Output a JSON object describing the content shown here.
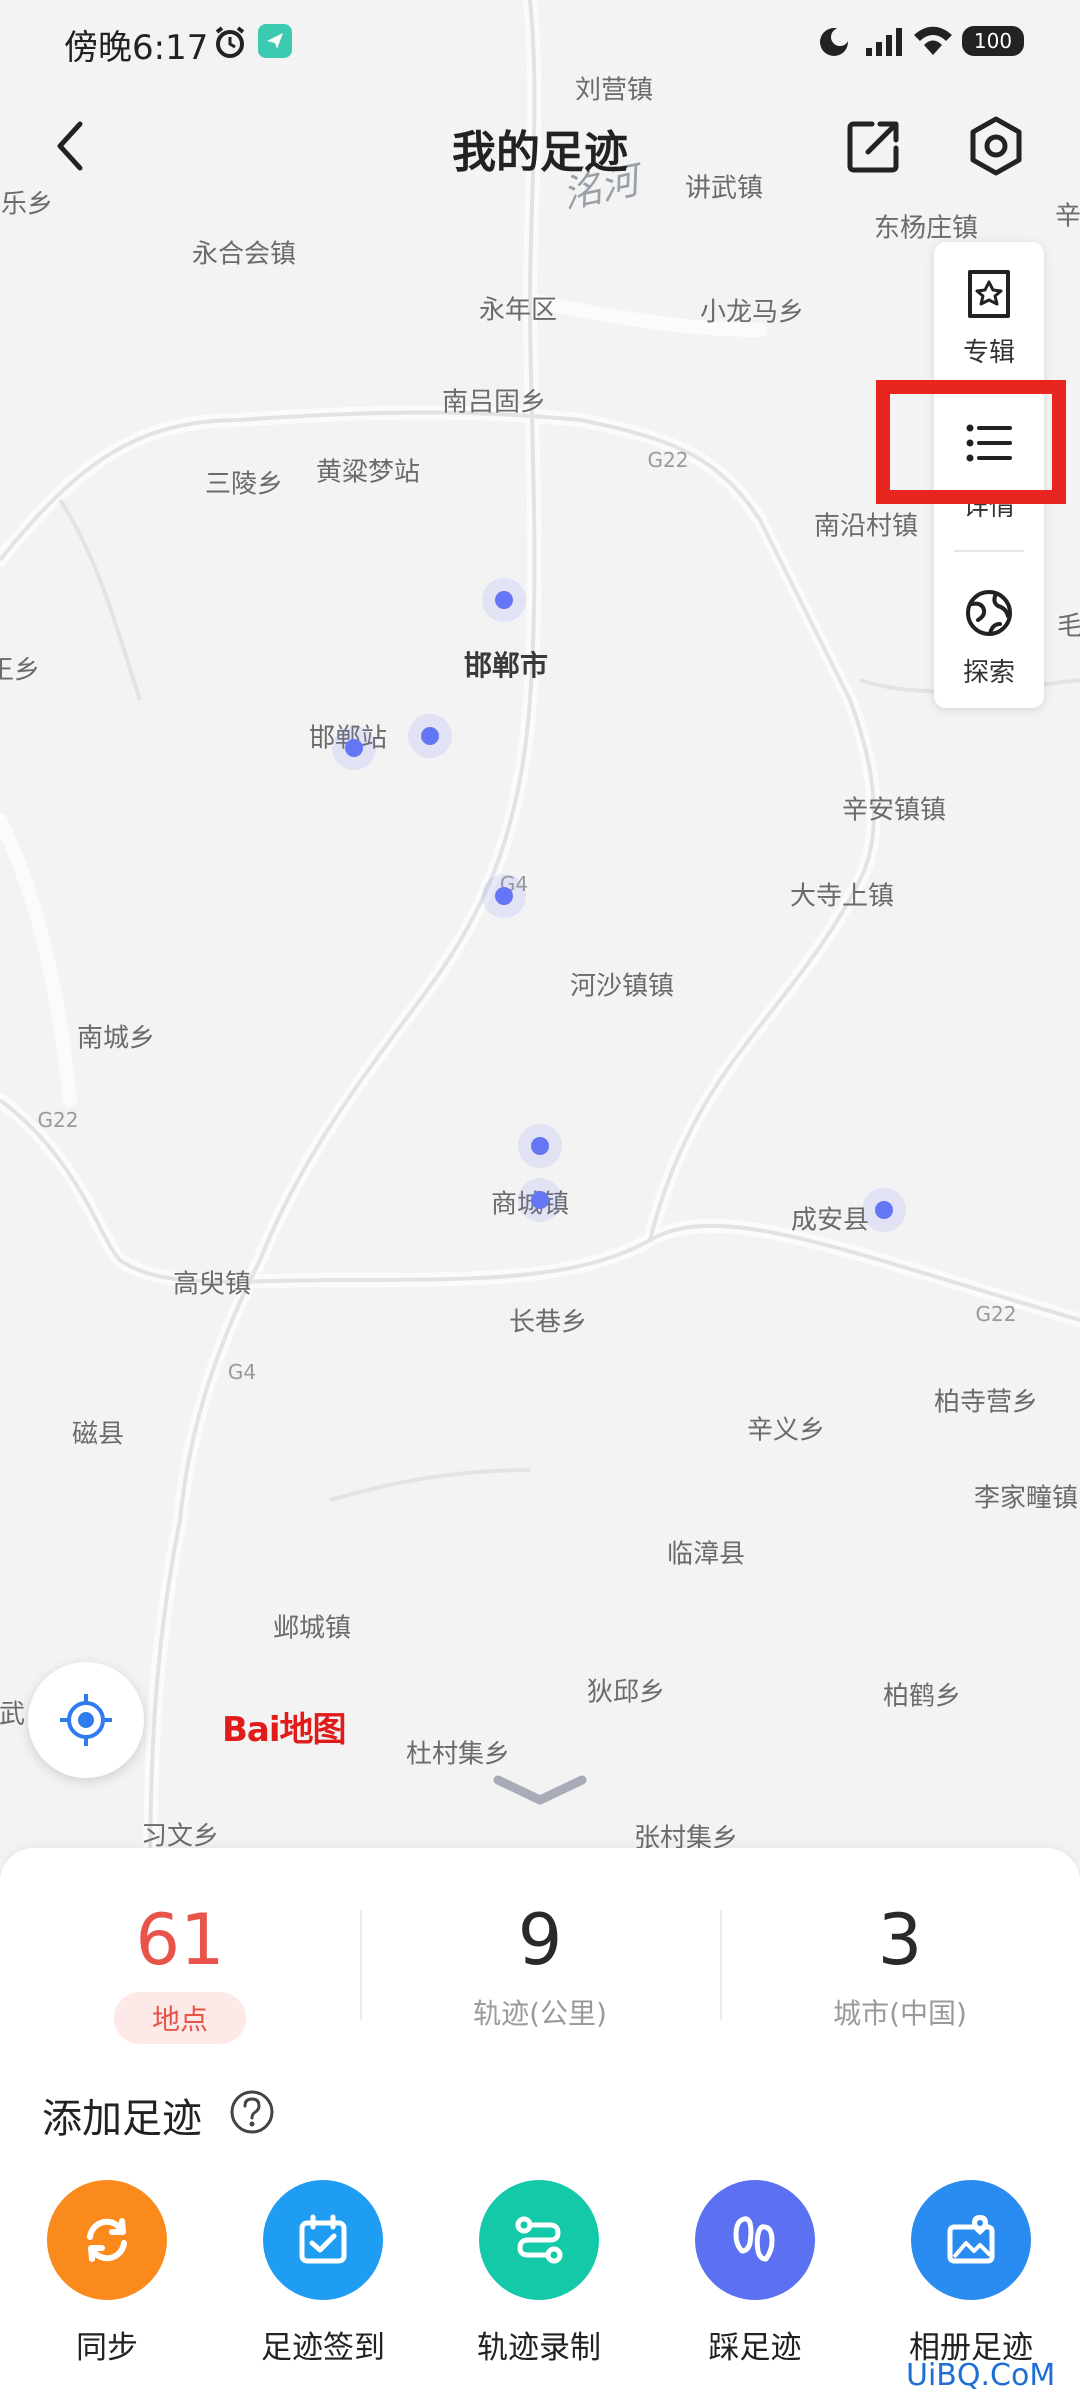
{
  "status_bar": {
    "time": "傍晚6:17",
    "battery": "100"
  },
  "header": {
    "title": "我的足迹"
  },
  "side_panel": {
    "items": [
      {
        "label": "专辑"
      },
      {
        "label": "详情"
      },
      {
        "label": "探索"
      }
    ]
  },
  "map": {
    "places": [
      "刘营镇",
      "洺河",
      "讲武镇",
      "东杨庄镇",
      "辛",
      "安乐乡",
      "永合会镇",
      "永年区",
      "小龙马乡",
      "南吕固乡",
      "三陵乡",
      "黄粱梦站",
      "G22",
      "南沿村镇",
      "邯郸市",
      "邯郸站",
      "辛安镇镇",
      "G4",
      "大寺上镇",
      "河沙镇镇",
      "南城乡",
      "G22",
      "商城镇",
      "成安县",
      "高臾镇",
      "长巷乡",
      "G22",
      "G4",
      "柏寺营乡",
      "磁县",
      "辛义乡",
      "李家疃镇",
      "临漳县",
      "邺城镇",
      "狄邱乡",
      "柏鹤乡",
      "杜村集乡",
      "习文乡",
      "张村集乡",
      "王乡",
      "毛",
      "武"
    ],
    "logo": "Bai地图"
  },
  "stats": [
    {
      "value": "61",
      "label": "地点"
    },
    {
      "value": "9",
      "label": "轨迹(公里)"
    },
    {
      "value": "3",
      "label": "城市(中国)"
    }
  ],
  "add_section": {
    "title": "添加足迹"
  },
  "actions": [
    {
      "label": "同步",
      "color": "#fb8a1c"
    },
    {
      "label": "足迹签到",
      "color": "#1e9df2"
    },
    {
      "label": "轨迹录制",
      "color": "#13c9a8"
    },
    {
      "label": "踩足迹",
      "color": "#5b71f2"
    },
    {
      "label": "相册足迹",
      "color": "#2a8cf0"
    }
  ],
  "watermark": "UiBQ.CoM"
}
